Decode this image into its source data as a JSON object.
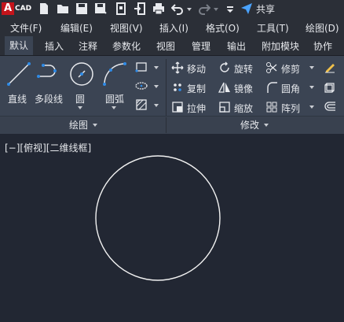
{
  "app": {
    "logo_letter": "A",
    "logo_text": "CAD",
    "share_label": "共享"
  },
  "menubar": [
    {
      "label": "文件(F)"
    },
    {
      "label": "编辑(E)"
    },
    {
      "label": "视图(V)"
    },
    {
      "label": "插入(I)"
    },
    {
      "label": "格式(O)"
    },
    {
      "label": "工具(T)"
    },
    {
      "label": "绘图(D)"
    }
  ],
  "tabs": [
    {
      "label": "默认"
    },
    {
      "label": "插入"
    },
    {
      "label": "注释"
    },
    {
      "label": "参数化"
    },
    {
      "label": "视图"
    },
    {
      "label": "管理"
    },
    {
      "label": "输出"
    },
    {
      "label": "附加模块"
    },
    {
      "label": "协作"
    }
  ],
  "draw_panel": {
    "title": "绘图",
    "tools": [
      {
        "label": "直线"
      },
      {
        "label": "多段线"
      },
      {
        "label": "圆"
      },
      {
        "label": "圆弧"
      }
    ]
  },
  "modify_panel": {
    "title": "修改",
    "tools": [
      {
        "label": "移动"
      },
      {
        "label": "旋转"
      },
      {
        "label": "修剪"
      },
      {
        "label": "复制"
      },
      {
        "label": "镜像"
      },
      {
        "label": "圆角"
      },
      {
        "label": "拉伸"
      },
      {
        "label": "缩放"
      },
      {
        "label": "阵列"
      }
    ]
  },
  "viewport": {
    "label": "[−][俯视][二维线框]"
  },
  "colors": {
    "ribbon_bg": "#3b4453",
    "canvas_bg": "#222733",
    "accent_blue": "#2f8be6"
  }
}
